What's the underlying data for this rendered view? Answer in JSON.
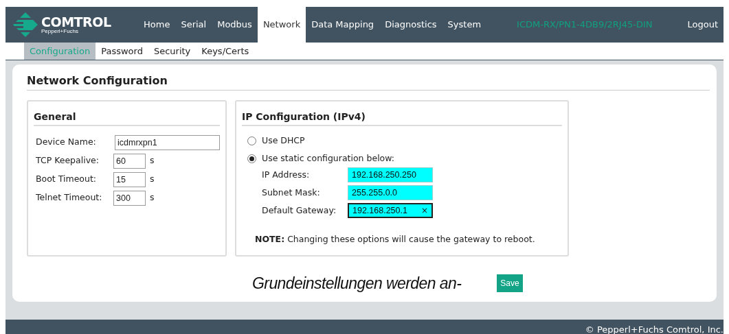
{
  "logo": {
    "name": "COMTROL",
    "tagline": "Pepperl+Fuchs"
  },
  "nav": [
    {
      "label": "Home",
      "selected": false
    },
    {
      "label": "Serial",
      "selected": false
    },
    {
      "label": "Modbus",
      "selected": false
    },
    {
      "label": "Network",
      "selected": true
    },
    {
      "label": "Data Mapping",
      "selected": false
    },
    {
      "label": "Diagnostics",
      "selected": false
    },
    {
      "label": "System",
      "selected": false
    }
  ],
  "device_model": "ICDM-RX/PN1-4DB9/2RJ45-DIN",
  "logout": "Logout",
  "subnav": [
    {
      "label": "Configuration",
      "selected": true
    },
    {
      "label": "Password",
      "selected": false
    },
    {
      "label": "Security",
      "selected": false
    },
    {
      "label": "Keys/Certs",
      "selected": false
    }
  ],
  "page_title": "Network Configuration",
  "general": {
    "title": "General",
    "fields": [
      {
        "label": "Device Name:",
        "value": "icdmrxpn1"
      },
      {
        "label": "TCP Keepalive:",
        "value": "60",
        "unit": "s"
      },
      {
        "label": "Boot Timeout:",
        "value": "15",
        "unit": "s"
      },
      {
        "label": "Telnet Timeout:",
        "value": "300",
        "unit": "s"
      }
    ]
  },
  "ip": {
    "title": "IP Configuration (IPv4)",
    "options": [
      {
        "label": "Use DHCP",
        "selected": false
      },
      {
        "label": "Use static configuration below:",
        "selected": true
      }
    ],
    "fields": [
      {
        "label": "IP Address:",
        "value": "192.168.250.250",
        "focused": false
      },
      {
        "label": "Subnet Mask:",
        "value": "255.255.0.0",
        "focused": false
      },
      {
        "label": "Default Gateway:",
        "value": "192.168.250.1",
        "focused": true,
        "clear": "×"
      }
    ],
    "note": "**NOTE:** Changing these options will cause the gateway to reboot."
  },
  "caption": "Grundeinstellungen werden an-",
  "save": "Save",
  "footer": "© Pepperl+Fuchs Comtrol, Inc."
}
